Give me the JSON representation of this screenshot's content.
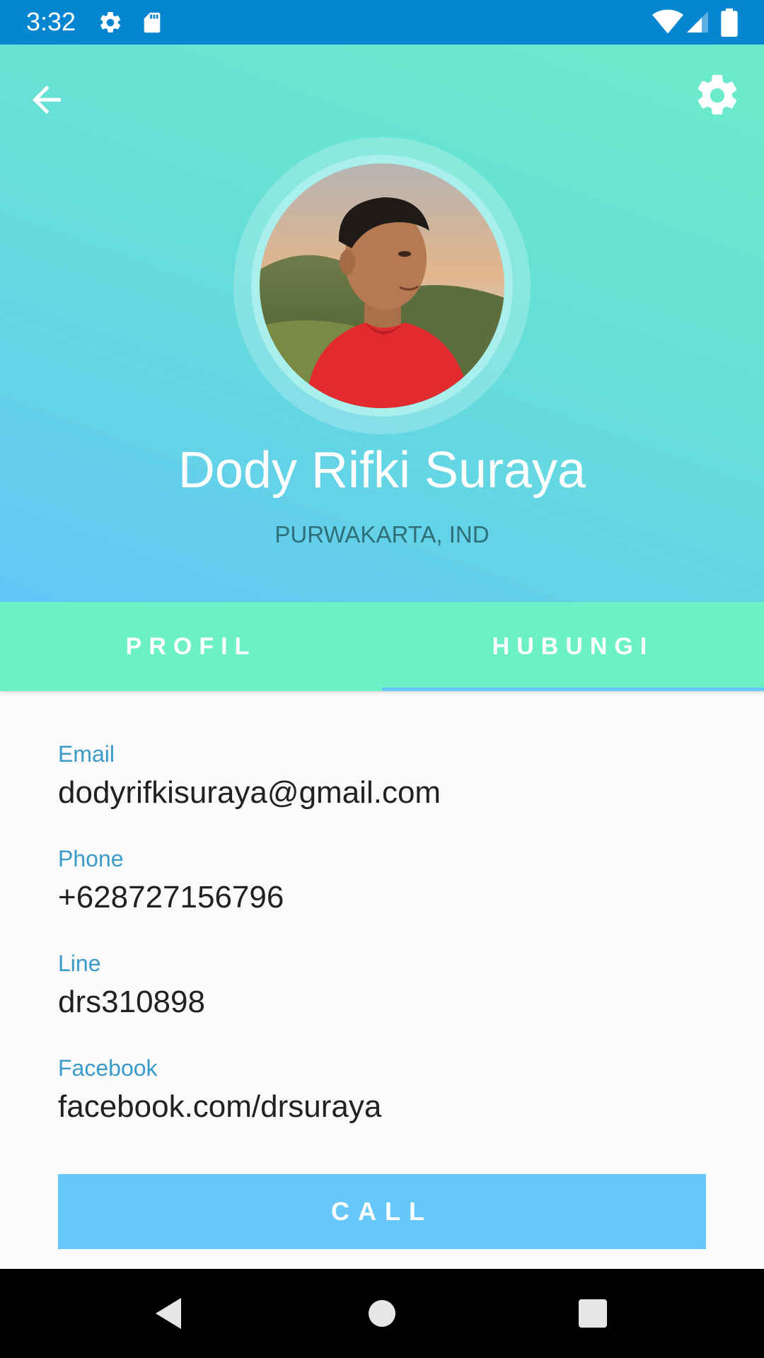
{
  "status_bar": {
    "time": "3:32",
    "icons": [
      "gear-icon",
      "sd-card-icon",
      "wifi-icon",
      "signal-icon",
      "battery-icon"
    ]
  },
  "header": {
    "back_icon": "arrow-left-icon",
    "settings_icon": "gear-icon",
    "name": "Dody Rifki Suraya",
    "location": "PURWAKARTA, IND"
  },
  "tabs": [
    {
      "label": "PROFIL",
      "selected": false
    },
    {
      "label": "HUBUNGI",
      "selected": true
    }
  ],
  "contact": {
    "email": {
      "label": "Email",
      "value": "dodyrifkisuraya@gmail.com"
    },
    "phone": {
      "label": "Phone",
      "value": "+628727156796"
    },
    "line": {
      "label": "Line",
      "value": "drs310898"
    },
    "facebook": {
      "label": "Facebook",
      "value": "facebook.com/drsuraya"
    }
  },
  "call_button": {
    "label": "CALL"
  },
  "nav_bar": {
    "icons": [
      "back-triangle-icon",
      "home-circle-icon",
      "recents-square-icon"
    ]
  },
  "colors": {
    "status_bar": "#0685d0",
    "tab_bar": "#6cf0c6",
    "accent": "#62c6f7",
    "label": "#3a9bc9"
  }
}
